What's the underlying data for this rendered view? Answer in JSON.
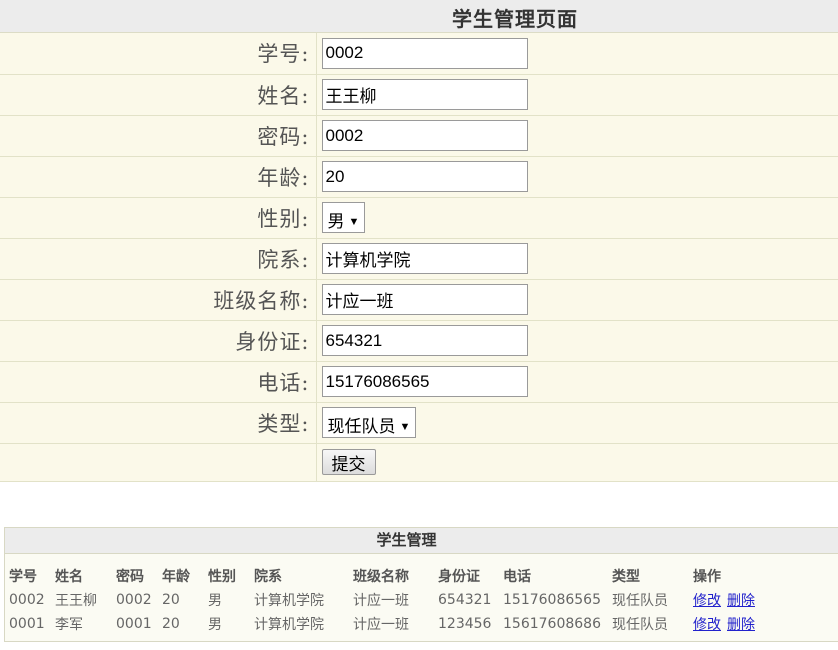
{
  "page": {
    "title": "学生管理页面"
  },
  "form": {
    "fields": {
      "student_id": {
        "label": "学号:",
        "value": "0002"
      },
      "name": {
        "label": "姓名:",
        "value": "王王柳"
      },
      "password": {
        "label": "密码:",
        "value": "0002"
      },
      "age": {
        "label": "年龄:",
        "value": "20"
      },
      "gender": {
        "label": "性别:",
        "value": "男"
      },
      "department": {
        "label": "院系:",
        "value": "计算机学院"
      },
      "class_name": {
        "label": "班级名称:",
        "value": "计应一班"
      },
      "id_card": {
        "label": "身份证:",
        "value": "654321"
      },
      "phone": {
        "label": "电话:",
        "value": "15176086565"
      },
      "type": {
        "label": "类型:",
        "value": "现任队员"
      }
    },
    "submit_label": "提交"
  },
  "list": {
    "title": "学生管理",
    "columns": [
      "学号",
      "姓名",
      "密码",
      "年龄",
      "性别",
      "院系",
      "班级名称",
      "身份证",
      "电话",
      "类型",
      "操作"
    ],
    "rows": [
      {
        "id": "0002",
        "name": "王王柳",
        "password": "0002",
        "age": "20",
        "gender": "男",
        "department": "计算机学院",
        "class": "计应一班",
        "id_card": "654321",
        "phone": "15176086565",
        "type": "现任队员",
        "edit": "修改",
        "delete": "删除"
      },
      {
        "id": "0001",
        "name": "李军",
        "password": "0001",
        "age": "20",
        "gender": "男",
        "department": "计算机学院",
        "class": "计应一班",
        "id_card": "123456",
        "phone": "15617608686",
        "type": "现任队员",
        "edit": "修改",
        "delete": "删除"
      }
    ]
  },
  "colors": {
    "form_bg": "#fbf9e9",
    "header_bg": "#ececec",
    "link": "#2222cc"
  }
}
